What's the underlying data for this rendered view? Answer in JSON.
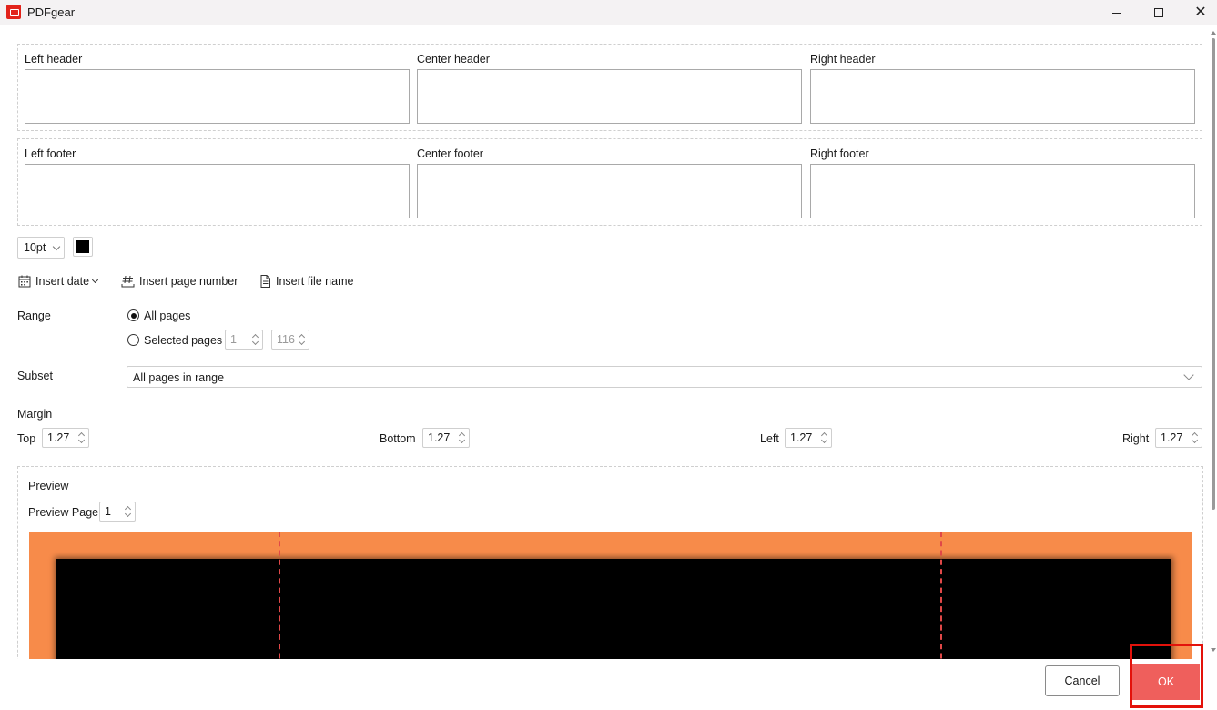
{
  "window": {
    "title": "PDFgear"
  },
  "headers": {
    "left_label": "Left header",
    "center_label": "Center header",
    "right_label": "Right header",
    "left_value": "",
    "center_value": "",
    "right_value": ""
  },
  "footers": {
    "left_label": "Left footer",
    "center_label": "Center footer",
    "right_label": "Right footer",
    "left_value": "",
    "center_value": "",
    "right_value": ""
  },
  "formatting": {
    "font_size": "10pt",
    "text_color": "#000000"
  },
  "insert_tools": {
    "date": "Insert date",
    "page_number": "Insert page number",
    "file_name": "Insert file name"
  },
  "range": {
    "label": "Range",
    "all_pages": "All pages",
    "selected_pages": "Selected pages",
    "selected": "All pages",
    "from": "1",
    "separator": "-",
    "to": "116"
  },
  "subset": {
    "label": "Subset",
    "value": "All pages in range"
  },
  "margin": {
    "label": "Margin",
    "top_label": "Top",
    "top": "1.27",
    "bottom_label": "Bottom",
    "bottom": "1.27",
    "left_label": "Left",
    "left": "1.27",
    "right_label": "Right",
    "right": "1.27"
  },
  "preview": {
    "label": "Preview",
    "page_label": "Preview Page",
    "page": "1",
    "background_color": "#f78b4a",
    "guide_color": "#e04848"
  },
  "actions": {
    "cancel": "Cancel",
    "ok": "OK",
    "ok_color": "#ef5f5c",
    "highlight_color": "#e3120b"
  }
}
